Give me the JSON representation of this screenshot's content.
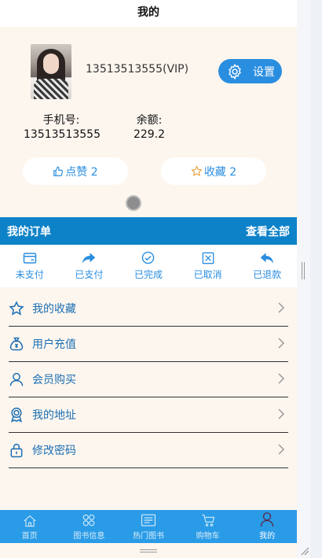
{
  "page": {
    "title": "我的"
  },
  "profile": {
    "account": "13513513555(VIP)",
    "settings_label": "设置",
    "phone_label": "手机号:",
    "phone_value": "13513513555",
    "balance_label": "余额:",
    "balance_value": "229.2",
    "likes_label": "点赞 2",
    "favorites_label": "收藏 2"
  },
  "orders": {
    "title": "我的订单",
    "view_all": "查看全部",
    "statuses": [
      {
        "label": "未支付",
        "icon": "card-icon"
      },
      {
        "label": "已支付",
        "icon": "forward-arrow-icon"
      },
      {
        "label": "已完成",
        "icon": "check-circle-icon"
      },
      {
        "label": "已取消",
        "icon": "x-box-icon"
      },
      {
        "label": "已退款",
        "icon": "return-arrow-icon"
      }
    ]
  },
  "menu": [
    {
      "label": "我的收藏",
      "icon": "star-icon"
    },
    {
      "label": "用户充值",
      "icon": "money-bag-icon"
    },
    {
      "label": "会员购买",
      "icon": "user-icon"
    },
    {
      "label": "我的地址",
      "icon": "badge-icon"
    },
    {
      "label": "修改密码",
      "icon": "lock-icon"
    }
  ],
  "tabs": [
    {
      "label": "首页",
      "icon": "home-icon"
    },
    {
      "label": "图书信息",
      "icon": "grid-icon"
    },
    {
      "label": "热门图书",
      "icon": "news-icon"
    },
    {
      "label": "购物车",
      "icon": "cart-icon"
    },
    {
      "label": "我的",
      "icon": "person-icon"
    }
  ],
  "colors": {
    "accent": "#2a8ee0",
    "header_bar": "#0e82c8",
    "tab_bar": "#2a9be6",
    "background": "#fdf6ef"
  }
}
